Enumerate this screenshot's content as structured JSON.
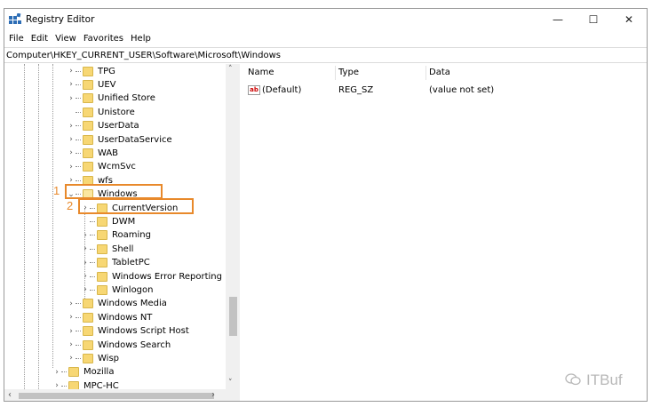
{
  "window": {
    "title": "Registry Editor",
    "controls": {
      "minimize": "—",
      "maximize": "☐",
      "close": "✕"
    }
  },
  "menu": [
    "File",
    "Edit",
    "View",
    "Favorites",
    "Help"
  ],
  "address": "Computer\\HKEY_CURRENT_USER\\Software\\Microsoft\\Windows",
  "tree": [
    {
      "label": "TPG",
      "expander": "›"
    },
    {
      "label": "UEV",
      "expander": "›"
    },
    {
      "label": "Unified Store",
      "expander": "›"
    },
    {
      "label": "Unistore",
      "expander": ""
    },
    {
      "label": "UserData",
      "expander": "›"
    },
    {
      "label": "UserDataService",
      "expander": "›"
    },
    {
      "label": "WAB",
      "expander": "›"
    },
    {
      "label": "WcmSvc",
      "expander": "›"
    },
    {
      "label": "wfs",
      "expander": "›"
    },
    {
      "label": "Windows",
      "expander": "⌄"
    },
    {
      "label": "CurrentVersion",
      "expander": "›"
    },
    {
      "label": "DWM",
      "expander": ""
    },
    {
      "label": "Roaming",
      "expander": "›"
    },
    {
      "label": "Shell",
      "expander": "›"
    },
    {
      "label": "TabletPC",
      "expander": "›"
    },
    {
      "label": "Windows Error Reporting",
      "expander": "›"
    },
    {
      "label": "Winlogon",
      "expander": "›"
    },
    {
      "label": "Windows Media",
      "expander": "›"
    },
    {
      "label": "Windows NT",
      "expander": "›"
    },
    {
      "label": "Windows Script Host",
      "expander": "›"
    },
    {
      "label": "Windows Search",
      "expander": "›"
    },
    {
      "label": "Wisp",
      "expander": "›"
    },
    {
      "label": "Mozilla",
      "expander": "›"
    },
    {
      "label": "MPC-HC",
      "expander": "›"
    }
  ],
  "columns": {
    "name": "Name",
    "type": "Type",
    "data": "Data"
  },
  "values": [
    {
      "name": "(Default)",
      "type": "REG_SZ",
      "data": "(value not set)",
      "icon": "ab"
    }
  ],
  "annotations": {
    "step1": "1",
    "step2": "2",
    "color": "#e8892b"
  },
  "watermark": "ITBuf",
  "scrollbars": {
    "up": "˄",
    "down": "˅",
    "left": "‹",
    "right": "›"
  }
}
